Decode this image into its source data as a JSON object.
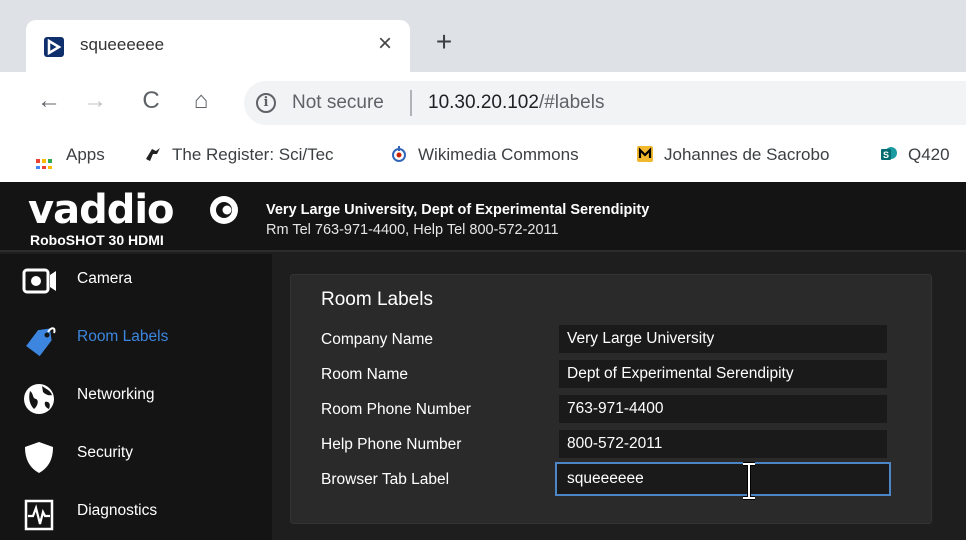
{
  "browser": {
    "tab_title": "squeeeeee",
    "close_glyph": "×",
    "newtab_glyph": "+",
    "nav": {
      "back": "←",
      "forward": "→",
      "reload": "C",
      "home": "⌂"
    },
    "info_glyph": "i",
    "security_label": "Not secure",
    "url_host": "10.30.20.102",
    "url_path": "/#labels",
    "bookmarks": [
      {
        "label": "Apps",
        "icon": "apps-grid-icon"
      },
      {
        "label": "The Register: Sci/Tec",
        "icon": "register-vulture-icon"
      },
      {
        "label": "Wikimedia Commons",
        "icon": "wikimedia-icon"
      },
      {
        "label": "Johannes de Sacrobo",
        "icon": "mizzou-icon"
      },
      {
        "label": "Q420",
        "icon": "sharepoint-icon"
      }
    ]
  },
  "app": {
    "brand": "vaddio",
    "model": "RoboSHOT 30 HDMI",
    "header_line1": "Very Large University, Dept of Experimental Serendipity",
    "header_line2": "Rm Tel 763-971-4400, Help Tel 800-572-2011",
    "nav_items": [
      {
        "label": "Camera",
        "icon": "camera-icon",
        "active": false
      },
      {
        "label": "Room Labels",
        "icon": "tag-icon",
        "active": true
      },
      {
        "label": "Networking",
        "icon": "globe-icon",
        "active": false
      },
      {
        "label": "Security",
        "icon": "shield-icon",
        "active": false
      },
      {
        "label": "Diagnostics",
        "icon": "pulse-icon",
        "active": false
      }
    ],
    "panel_title": "Room Labels",
    "fields": [
      {
        "label": "Company Name",
        "value": "Very Large University"
      },
      {
        "label": "Room Name",
        "value": "Dept of Experimental Serendipity"
      },
      {
        "label": "Room Phone Number",
        "value": "763-971-4400"
      },
      {
        "label": "Help Phone Number",
        "value": "800-572-2011"
      },
      {
        "label": "Browser Tab Label",
        "value": "squeeeeee"
      }
    ],
    "colors": {
      "accent": "#3d86e0",
      "focus_border": "#4d86c6",
      "background": "#1e1e1e"
    }
  }
}
